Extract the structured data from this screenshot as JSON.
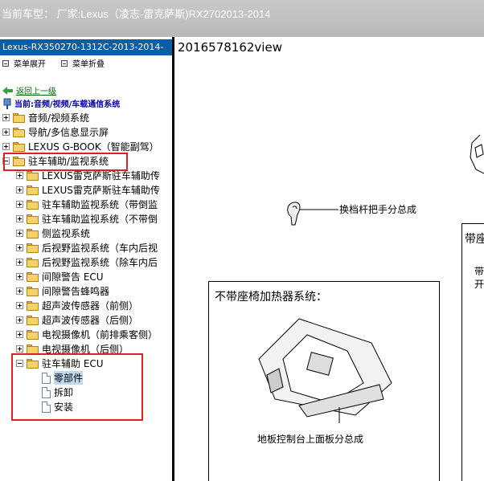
{
  "titlebar": {
    "title": "当前车型：  厂家:Lexus（凌志-雷克萨斯)RX2702013-2014"
  },
  "left_panel": {
    "header": "Lexus-RX350270-1312C-2013-2014-",
    "toolbar": {
      "expand_label": "菜单展开",
      "collapse_label": "菜单折叠"
    },
    "back_link": "返回上一级",
    "current_path": "当前:音频/视频/车载通信系统",
    "top_items": [
      {
        "label": "音频/视频系统"
      },
      {
        "label": "导航/多信息显示屏"
      },
      {
        "label": "LEXUS G-BOOK（智能副驾）"
      },
      {
        "label": "驻车辅助/监视系统"
      }
    ],
    "sub_items": [
      {
        "label": "LEXUS雷克萨斯驻车辅助传"
      },
      {
        "label": "LEXUS雷克萨斯驻车辅助传"
      },
      {
        "label": "驻车辅助监视系统（带倒监"
      },
      {
        "label": "驻车辅助监视系统（不带倒"
      },
      {
        "label": "侧监视系统"
      },
      {
        "label": "后视野监视系统（车内后视"
      },
      {
        "label": "后视野监视系统（除车内后"
      },
      {
        "label": "间隙警告 ECU"
      },
      {
        "label": "间隙警告蜂鸣器"
      },
      {
        "label": "超声波传感器（前侧）"
      },
      {
        "label": "超声波传感器（后侧）"
      },
      {
        "label": "电视摄像机（前排乘客侧）"
      },
      {
        "label": "电视摄像机（后侧）"
      },
      {
        "label": "驻车辅助 ECU"
      }
    ],
    "leaf_items": [
      {
        "label": "零部件",
        "selected": true
      },
      {
        "label": "拆卸"
      },
      {
        "label": "安装"
      }
    ]
  },
  "right_panel": {
    "view_title": "2016578162view",
    "shift_knob_label": "换档杆把手分总成",
    "box1_title": "不带座椅加热器系统：",
    "console_label": "地板控制台上面板分总成",
    "box2_title": "带座",
    "box2_text1": "带",
    "box2_text2": "开"
  },
  "colors": {
    "highlight": "#e02020",
    "header_blue": "#0a5ea8",
    "link_green": "#006600"
  }
}
